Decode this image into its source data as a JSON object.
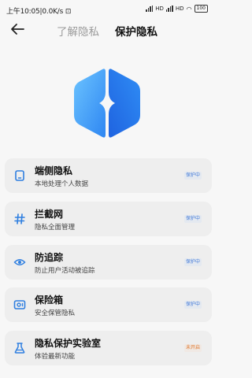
{
  "status_bar": {
    "time": "上午10:05",
    "speed": "0.0K/s",
    "network_labels": [
      "HD",
      "HD"
    ],
    "battery": "100"
  },
  "header": {
    "back_icon": "arrow-left-icon",
    "tabs": [
      {
        "label": "了解隐私",
        "active": false
      },
      {
        "label": "保护隐私",
        "active": true
      }
    ]
  },
  "logo": {
    "icon": "privacy-shield-logo",
    "colors": {
      "light": "#5fb7ff",
      "dark": "#2f7ff0"
    }
  },
  "items": [
    {
      "icon": "phone-icon",
      "title": "端侧隐私",
      "subtitle": "本地处理个人数据",
      "status": "保护中",
      "status_type": "on"
    },
    {
      "icon": "hash-icon",
      "title": "拦截网",
      "subtitle": "隐私全面管理",
      "status": "保护中",
      "status_type": "on"
    },
    {
      "icon": "eye-icon",
      "title": "防追踪",
      "subtitle": "防止用户活动被追踪",
      "status": "保护中",
      "status_type": "on"
    },
    {
      "icon": "safe-box-icon",
      "title": "保险箱",
      "subtitle": "安全保管隐私",
      "status": "保护中",
      "status_type": "on"
    },
    {
      "icon": "flask-icon",
      "title": "隐私保护实验室",
      "subtitle": "体验最新功能",
      "status": "未开启",
      "status_type": "off"
    }
  ],
  "colors": {
    "accent": "#2f7ff0",
    "icon_blue": "#2f7fe0",
    "status_on": "#4a7fd9",
    "status_off": "#e0762a",
    "card_bg": "#eeeeee"
  }
}
